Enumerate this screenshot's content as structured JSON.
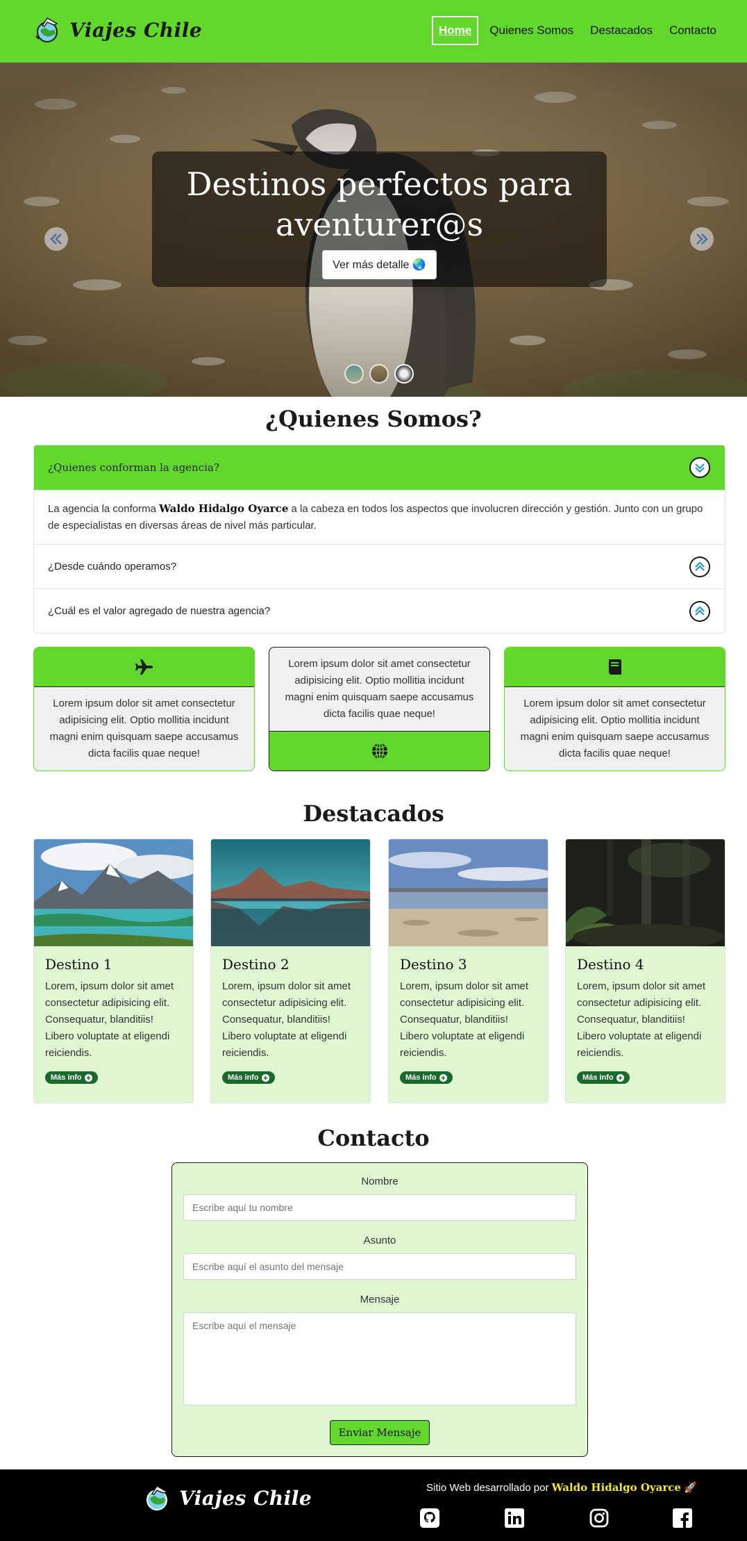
{
  "navbar": {
    "brand": "Viajes Chile",
    "links": [
      "Home",
      "Quienes Somos",
      "Destacados",
      "Contacto"
    ],
    "active_index": 0,
    "accent_color": "#63d82c"
  },
  "hero": {
    "title_line1": "Destinos perfectos para",
    "title_line2": "aventurer@s",
    "button_label": "Ver más detalle",
    "button_icon": "globe-emoji",
    "slides": 3,
    "active_slide": 0
  },
  "about": {
    "title": "¿Quienes Somos?",
    "items": [
      {
        "question": "¿Quienes conforman la agencia?",
        "open": true,
        "answer_prefix": "La agencia la conforma ",
        "answer_name": "Waldo Hidalgo Oyarce",
        "answer_suffix": " a la cabeza en todos los aspectos que involucren dirección y gestión. Junto con un grupo de especialistas en diversas áreas de nivel más particular."
      },
      {
        "question": "¿Desde cuándo operamos?",
        "open": false
      },
      {
        "question": "¿Cuál es el valor agregado de nuestra agencia?",
        "open": false
      }
    ]
  },
  "features": [
    {
      "icon": "airplane-icon",
      "text": "Lorem ipsum dolor sit amet consectetur adipisicing elit. Optio mollitia incidunt magni enim quisquam saepe accusamus dicta facilis quae neque!"
    },
    {
      "icon": "globe-icon",
      "text": "Lorem ipsum dolor sit amet consectetur adipisicing elit. Optio mollitia incidunt magni enim quisquam saepe accusamus dicta facilis quae neque!"
    },
    {
      "icon": "book-icon",
      "text": "Lorem ipsum dolor sit amet consectetur adipisicing elit. Optio mollitia incidunt magni enim quisquam saepe accusamus dicta facilis quae neque!"
    }
  ],
  "destacados": {
    "title": "Destacados",
    "cards": [
      {
        "title": "Destino 1",
        "text": "Lorem, ipsum dolor sit amet consectetur adipisicing elit. Consequatur, blanditiis! Libero voluptate at eligendi reiciendis.",
        "button": "Más info"
      },
      {
        "title": "Destino 2",
        "text": "Lorem, ipsum dolor sit amet consectetur adipisicing elit. Consequatur, blanditiis! Libero voluptate at eligendi reiciendis.",
        "button": "Más info"
      },
      {
        "title": "Destino 3",
        "text": "Lorem, ipsum dolor sit amet consectetur adipisicing elit. Consequatur, blanditiis! Libero voluptate at eligendi reiciendis.",
        "button": "Más info"
      },
      {
        "title": "Destino 4",
        "text": "Lorem, ipsum dolor sit amet consectetur adipisicing elit. Consequatur, blanditiis! Libero voluptate at eligendi reiciendis.",
        "button": "Más info"
      }
    ]
  },
  "contacto": {
    "title": "Contacto",
    "name_label": "Nombre",
    "name_placeholder": "Escribe aquí tu nombre",
    "subject_label": "Asunto",
    "subject_placeholder": "Escribe aquí el asunto del mensaje",
    "message_label": "Mensaje",
    "message_placeholder": "Escribe aquí el mensaje",
    "submit_label": "Enviar Mensaje"
  },
  "footer": {
    "brand": "Viajes Chile",
    "credit_prefix": "Sitio Web desarrollado por ",
    "credit_author": "Waldo Hidalgo Oyarce",
    "credit_icon": "rocket-emoji",
    "social": [
      "github-icon",
      "linkedin-icon",
      "instagram-icon",
      "facebook-icon"
    ]
  }
}
